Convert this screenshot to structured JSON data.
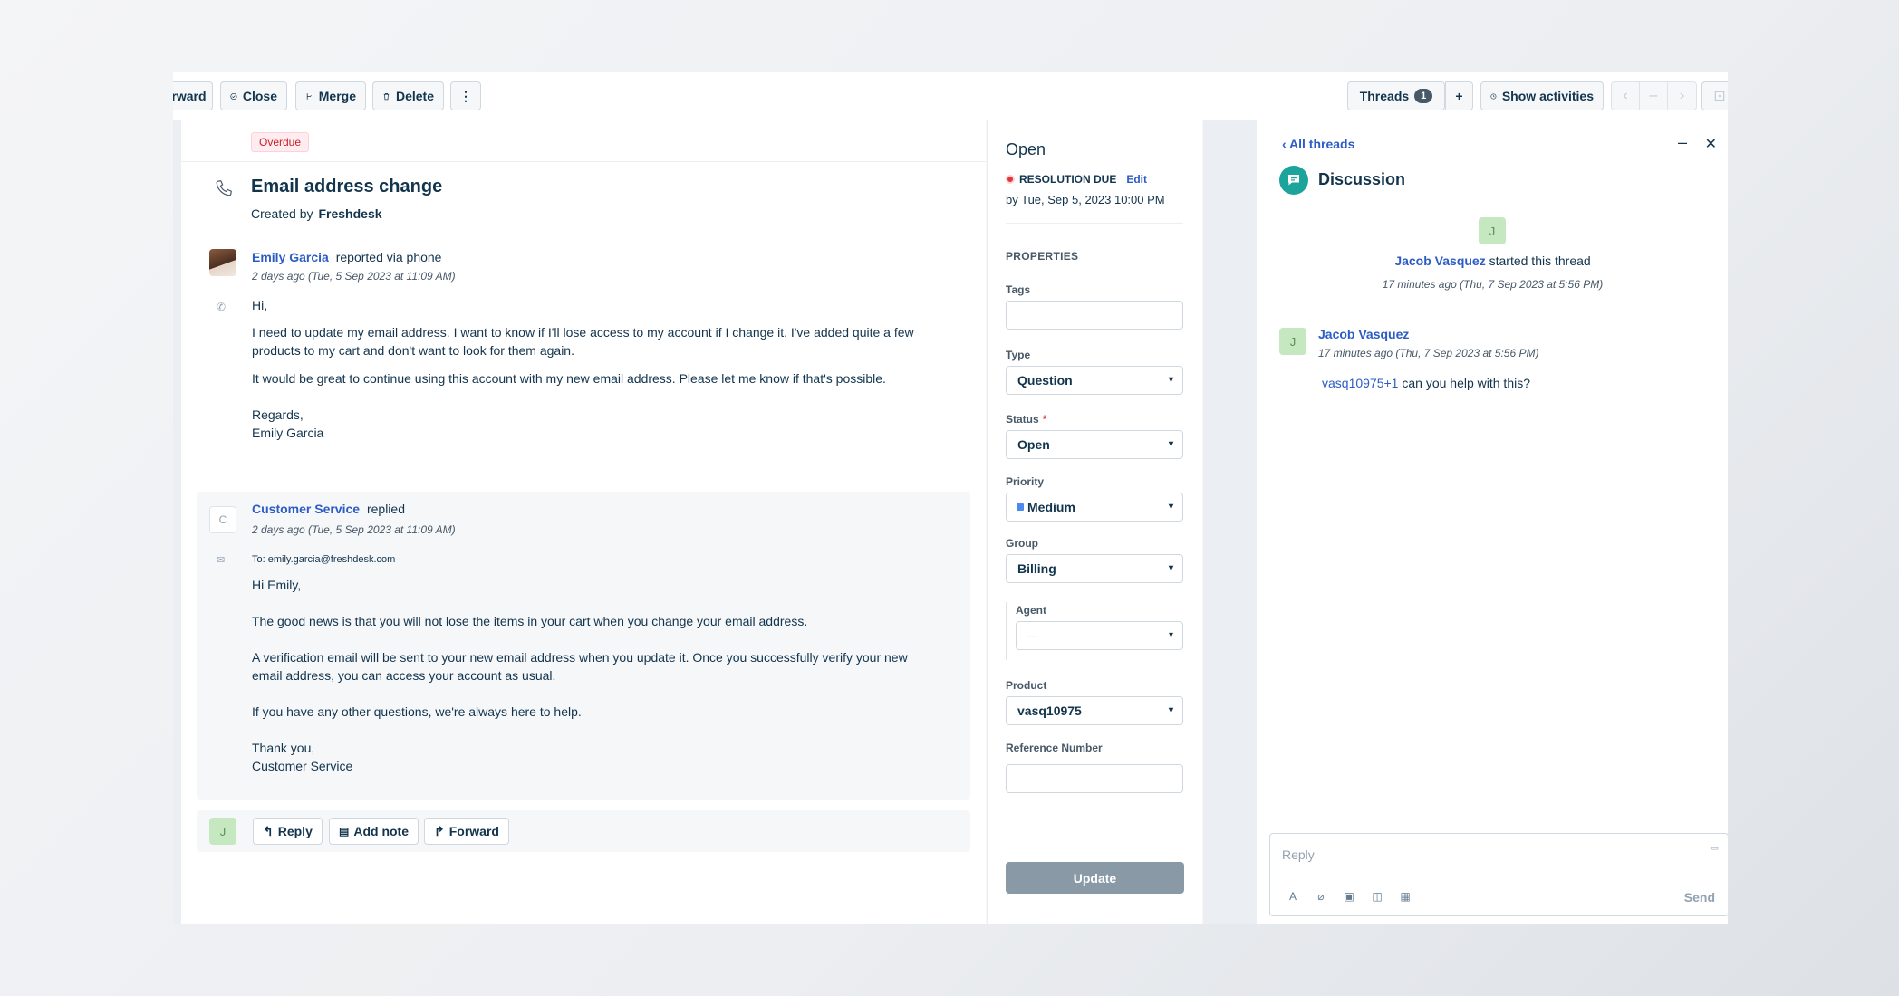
{
  "toolbar": {
    "forward_label": "rward",
    "close_label": "Close",
    "merge_label": "Merge",
    "delete_label": "Delete",
    "more_label": "⋮",
    "threads_label": "Threads",
    "threads_count": "1",
    "add_label": "+",
    "show_activities_label": "Show activities"
  },
  "ticket": {
    "overdue_label": "Overdue",
    "subject": "Email address change",
    "created_by_prefix": "Created by",
    "created_by": "Freshdesk",
    "requester": {
      "name": "Emily Garcia",
      "action": "reported via phone",
      "timestamp": "2 days ago (Tue, 5 Sep 2023 at 11:09 AM)",
      "body": [
        "Hi,",
        "I need to update my email address. I want to know if I'll lose access to my account if I change it. I've added quite a few products to my cart and don't want to look for them again.",
        "It would be great to continue using this account with my new email address. Please let me know if that's possible.",
        "Regards,",
        "Emily Garcia"
      ]
    },
    "reply": {
      "avatar_letter": "C",
      "name": "Customer Service",
      "action": "replied",
      "timestamp": "2 days ago (Tue, 5 Sep 2023 at 11:09 AM)",
      "to": "To: emily.garcia@freshdesk.com",
      "body": [
        "Hi Emily,",
        "The good news is that you will not lose the items in your cart when you change your email address.",
        "A verification email will be sent to your new email address when you update it. Once you successfully verify your new email address, you can access your account as usual.",
        "If you have any other questions, we're always here to help.",
        "Thank you,",
        "Customer Service"
      ]
    },
    "actions": {
      "avatar_letter": "J",
      "reply_label": "Reply",
      "add_note_label": "Add note",
      "forward_label": "Forward"
    }
  },
  "properties": {
    "status_title": "Open",
    "resolution_due_label": "RESOLUTION DUE",
    "edit_label": "Edit",
    "resolution_due_by": "by Tue, Sep 5, 2023 10:00 PM",
    "section_title": "PROPERTIES",
    "tags_label": "Tags",
    "type_label": "Type",
    "type_value": "Question",
    "status_label": "Status",
    "status_required": "*",
    "status_value": "Open",
    "priority_label": "Priority",
    "priority_value": "Medium",
    "priority_color": "#4d8af0",
    "group_label": "Group",
    "group_value": "Billing",
    "agent_label": "Agent",
    "agent_value": "--",
    "product_label": "Product",
    "product_value": "vasq10975",
    "reference_label": "Reference Number",
    "update_label": "Update"
  },
  "threads": {
    "back_label": "‹ All threads",
    "title": "Discussion",
    "starter_avatar": "J",
    "starter_name": "Jacob Vasquez",
    "starter_action": "started this thread",
    "starter_time": "17 minutes ago (Thu, 7 Sep 2023 at 5:56 PM)",
    "message": {
      "avatar": "J",
      "name": "Jacob Vasquez",
      "time": "17 minutes ago (Thu, 7 Sep 2023 at 5:56 PM)",
      "mention": "vasq10975+1",
      "text": "can you help with this?"
    },
    "reply_placeholder": "Reply",
    "send_label": "Send"
  },
  "colors": {
    "accent_link": "#2c5cc5",
    "overdue_red": "#c82124",
    "discussion_teal": "#1ba39c",
    "update_button": "#899aa6"
  }
}
